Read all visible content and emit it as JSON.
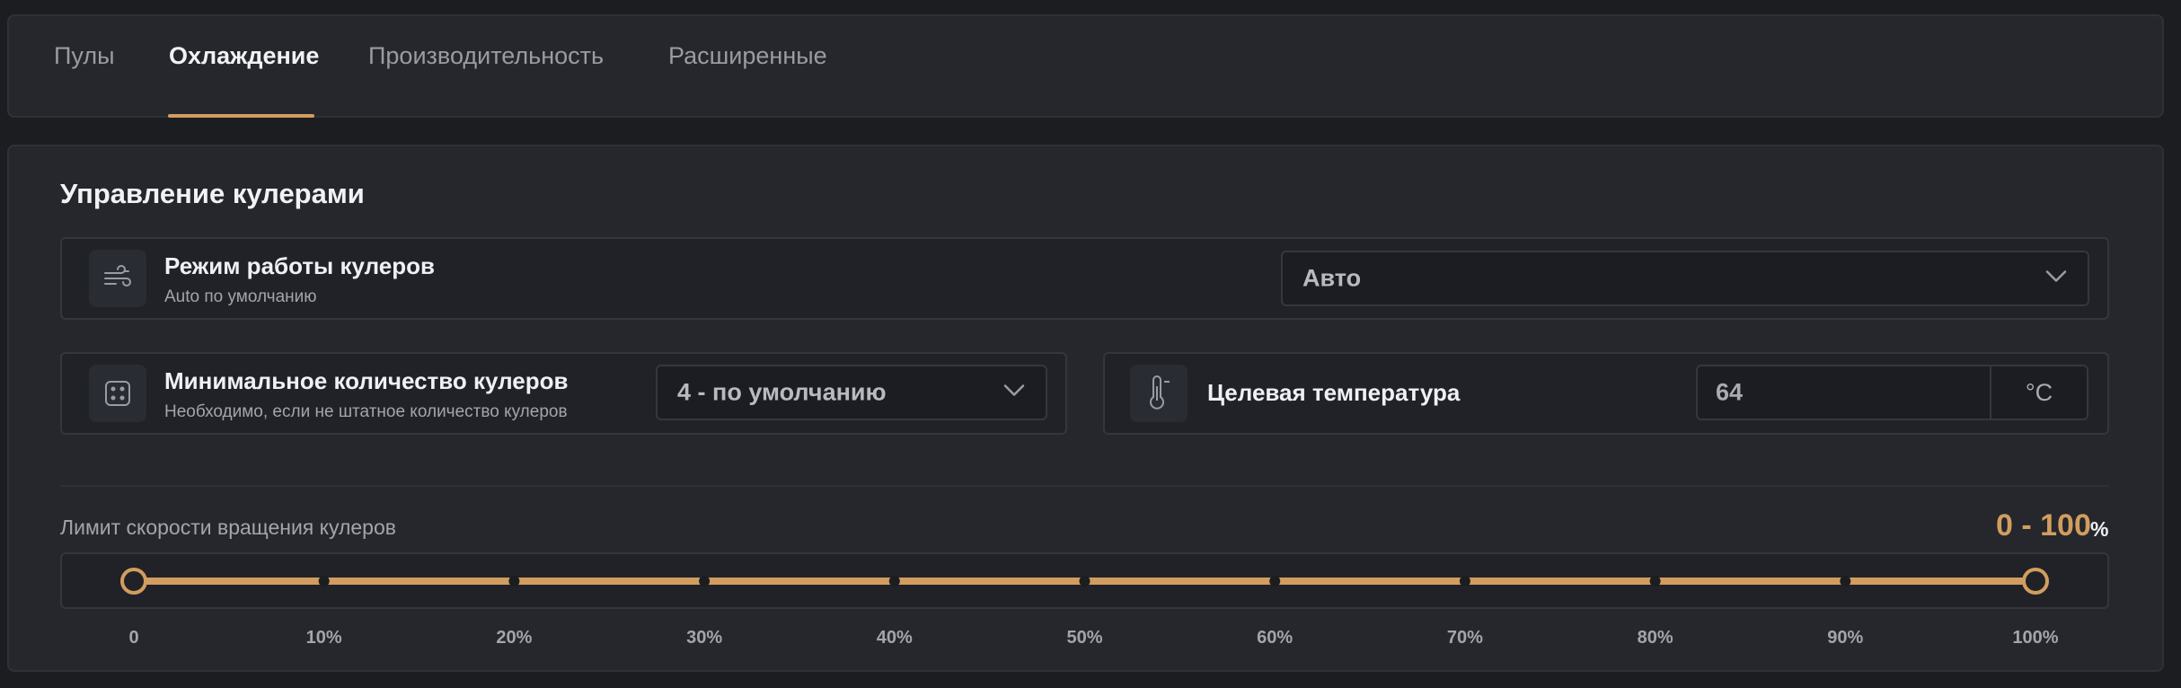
{
  "tabs": [
    {
      "label": "Пулы",
      "active": false
    },
    {
      "label": "Охлаждение",
      "active": true
    },
    {
      "label": "Производительность",
      "active": false
    },
    {
      "label": "Расширенные",
      "active": false
    }
  ],
  "section": {
    "title": "Управление кулерами"
  },
  "fan_mode": {
    "icon": "wind-icon",
    "title": "Режим работы кулеров",
    "subtitle": "Auto по умолчанию",
    "value": "Авто"
  },
  "min_fans": {
    "icon": "fan-count-icon",
    "title": "Минимальное количество кулеров",
    "subtitle": "Необходимо, если не штатное количество кулеров",
    "value": "4 - по умолчанию"
  },
  "target_temp": {
    "icon": "thermometer-icon",
    "title": "Целевая температура",
    "value": "64",
    "unit": "°C"
  },
  "speed_limit": {
    "label": "Лимит скорости вращения кулеров",
    "range_text": "0 - 100",
    "unit": "%",
    "min": 0,
    "max": 100,
    "ticks": [
      "0",
      "10%",
      "20%",
      "30%",
      "40%",
      "50%",
      "60%",
      "70%",
      "80%",
      "90%",
      "100%"
    ]
  },
  "colors": {
    "accent": "#d29d5f",
    "panel": "#25272d",
    "background": "#1c1d20"
  }
}
